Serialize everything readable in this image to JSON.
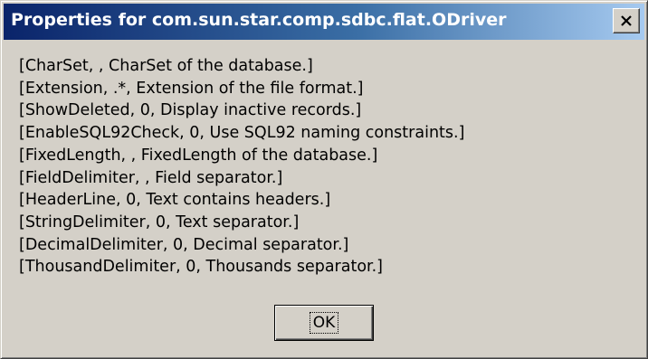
{
  "window": {
    "title": "Properties for com.sun.star.comp.sdbc.flat.ODriver",
    "close_icon": "close-x-icon"
  },
  "properties": [
    "[CharSet, , CharSet of the database.]",
    "[Extension, .*, Extension of the file format.]",
    "[ShowDeleted, 0, Display inactive records.]",
    "[EnableSQL92Check, 0, Use SQL92 naming constraints.]",
    "[FixedLength, , FixedLength of the database.]",
    "[FieldDelimiter, , Field separator.]",
    "[HeaderLine, 0, Text contains headers.]",
    "[StringDelimiter, 0, Text separator.]",
    "[DecimalDelimiter, 0, Decimal separator.]",
    "[ThousandDelimiter, 0, Thousands separator.]"
  ],
  "buttons": {
    "ok_label": "OK"
  },
  "colors": {
    "titlebar_start": "#0a246a",
    "titlebar_end": "#a6caf0",
    "face": "#d4d0c8"
  }
}
